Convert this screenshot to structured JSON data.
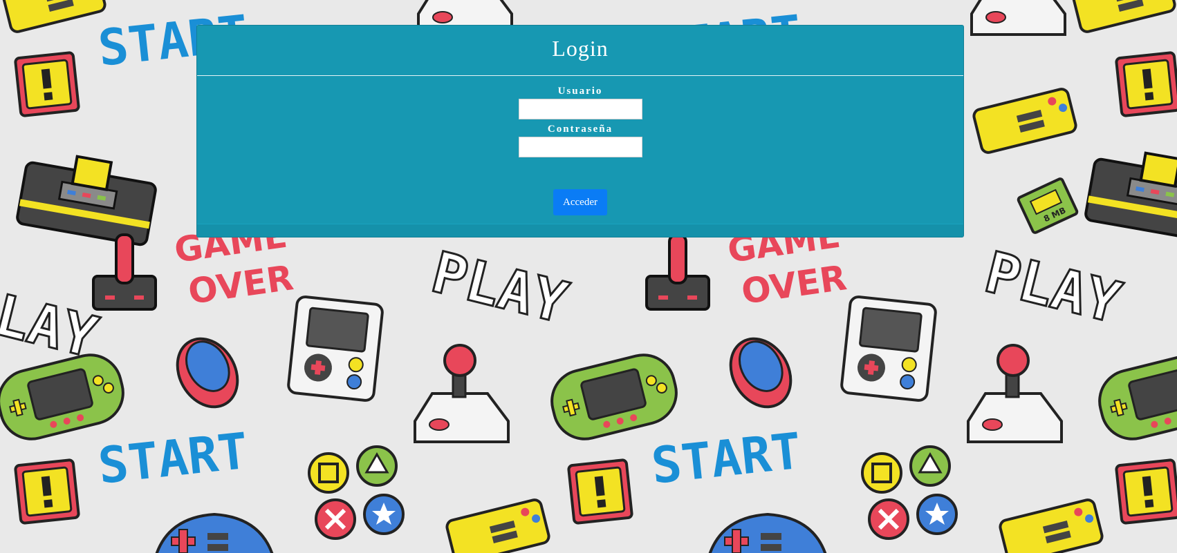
{
  "login": {
    "title": "Login",
    "username_label": "Usuario",
    "username_value": "",
    "password_label": "Contraseña",
    "password_value": "",
    "submit_label": "Acceder"
  },
  "background": {
    "texts": [
      "START",
      "GAME",
      "OVER",
      "PLAY",
      "8 MB"
    ],
    "icons": [
      "start-text-icon",
      "game-over-text-icon",
      "play-text-icon",
      "warning-block-icon",
      "retro-console-icon",
      "joystick-icon",
      "gamepad-icon",
      "handheld-console-icon",
      "mouse-icon",
      "game-buttons-icon",
      "memory-card-icon"
    ],
    "colors": {
      "page": "#e9e9e9",
      "panel": "#1798b2",
      "button": "#0a7cf5",
      "start_blue": "#1a8fd6",
      "gameover_red": "#e8475a",
      "warning_yellow": "#f3e223",
      "handheld_green": "#8bc34a"
    }
  }
}
